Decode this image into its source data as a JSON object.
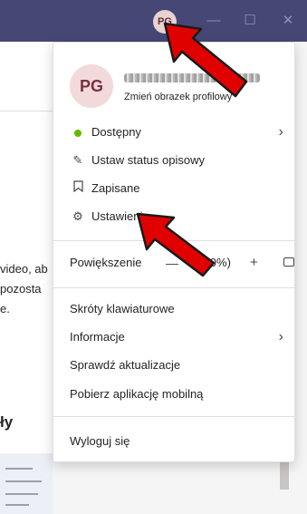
{
  "titlebar": {
    "avatar_initials": "PG",
    "minimize_glyph": "—",
    "maximize_glyph": "☐",
    "close_glyph": "✕"
  },
  "background": {
    "fragments": [
      "video, ab",
      "pozosta",
      "e.",
      "ły"
    ]
  },
  "profile": {
    "avatar_initials": "PG",
    "change_picture": "Zmień obrazek profilowy"
  },
  "menu": {
    "status_label": "Dostępny",
    "set_status_message": "Ustaw status opisowy",
    "saved": "Zapisane",
    "settings": "Ustawienia",
    "zoom_label": "Powiększenie",
    "zoom_value": "(100%)",
    "zoom_minus": "—",
    "zoom_plus": "+",
    "keyboard_shortcuts": "Skróty klawiaturowe",
    "about": "Informacje",
    "check_updates": "Sprawdź aktualizacje",
    "download_mobile": "Pobierz aplikację mobilną",
    "sign_out": "Wyloguj się"
  },
  "colors": {
    "titlebar": "#464775",
    "status_available": "#6bb700",
    "annotation_arrow": "#e00000"
  },
  "icons": [
    "status-dot",
    "chevron-right-icon",
    "edit-icon",
    "bookmark-icon",
    "gear-icon",
    "fullscreen-icon"
  ]
}
